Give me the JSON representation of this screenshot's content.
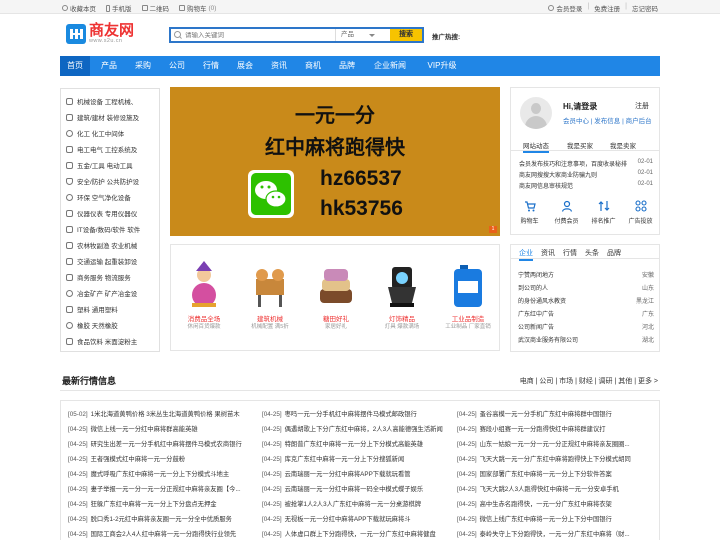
{
  "topbar": {
    "favorite": "收藏本页",
    "mobile": "手机版",
    "qrcode": "二维码",
    "cart": "购物车",
    "cart_count": "(0)",
    "login": "会员登录",
    "sep": "|",
    "register": "免费注册",
    "forgot": "忘记密码"
  },
  "logo": {
    "name": "商友网",
    "url_text": "www.s2u.cn"
  },
  "search": {
    "placeholder": "请输入关键词",
    "category": "产品",
    "button": "搜索",
    "hot_label": "推广热搜:"
  },
  "nav": [
    "首页",
    "产品",
    "采购",
    "公司",
    "行情",
    "展会",
    "资讯",
    "商机",
    "品牌",
    "企业新闻",
    "VIP升级"
  ],
  "categories": [
    "机械设备 工程机械、",
    "建筑/建材 装修设施及",
    "化工 化工中间体",
    "电工电气 工控系统及",
    "五金/工具 电动工具",
    "安全/防护 公共防护设",
    "环保 空气净化设备",
    "仪器仪表 专用仪器仪",
    "IT设备/数码/软件 软件",
    "农林牧副渔 农业机械",
    "交通运输 起重装卸设",
    "商务服务 物流服务",
    "冶金矿产 矿产冶金设",
    "塑料 通用塑料",
    "橡胶 天然橡胶",
    "食品饮料 米面淀粉主"
  ],
  "banner": {
    "line1": "一元一分",
    "line2": "红中麻将跑得快",
    "code1": "hz66537",
    "code2": "hk53756",
    "indicator": "1"
  },
  "products": [
    {
      "name": "消费品全场",
      "sub": "休闲百货爆款"
    },
    {
      "name": "建筑机械",
      "sub": "机械配置 满5折"
    },
    {
      "name": "糖田好礼",
      "sub": "家居好礼"
    },
    {
      "name": "灯饰精品",
      "sub": "灯具 爆款满场"
    },
    {
      "name": "工业品制造",
      "sub": "工业制品 厂家直销"
    }
  ],
  "user": {
    "greeting": "Hi,请登录",
    "register": "注册",
    "links": "会员中心 | 发布信息 | 商户后台",
    "tabs": [
      "网站动态",
      "我是买家",
      "我是卖家"
    ],
    "news": [
      {
        "text": "会员发布技巧和注意事项，百度收录秘排",
        "date": "02-01"
      },
      {
        "text": "商友网搜搜大家商业防骗九则",
        "date": "02-01"
      },
      {
        "text": "商友网信息审核规范",
        "date": "02-01"
      }
    ],
    "quick": [
      "购物车",
      "付费会员",
      "排名推广",
      "广告投放"
    ]
  },
  "biz": {
    "tabs": [
      "企业",
      "资讯",
      "行情",
      "头条",
      "品牌"
    ],
    "rows": [
      {
        "name": "宁赞两闭地方",
        "region": "安徽"
      },
      {
        "name": "到公司的人",
        "region": "山东"
      },
      {
        "name": "的身份通风水教资",
        "region": "黑龙江"
      },
      {
        "name": "广东红中广告",
        "region": "广东"
      },
      {
        "name": "公司新闻广告",
        "region": "河北"
      },
      {
        "name": "武汉商业服务有限公司",
        "region": "湖北"
      }
    ]
  },
  "market": {
    "title": "最新行情信息",
    "links": "电商 | 公司 | 市场 | 财经 | 调研 | 其他 | 更多 >",
    "col1": [
      [
        "[05-02]",
        "1米北海道黄鸭价格 3米丛生北海道黄鸭价格 果树苗木"
      ],
      [
        "[04-25]",
        "微信上线一元一分红中麻将群高能英雄"
      ],
      [
        "[04-25]",
        "研究生出差一元一分手机红中麻将摆件马模式农商银行"
      ],
      [
        "[04-25]",
        "王者强模式红中麻将一元一分鼓粉"
      ],
      [
        "[04-25]",
        "魔式呼吸广东红中麻将一元一分上下分模式斗地主"
      ],
      [
        "[04-25]",
        "妻子举报一元一分一元一分正规红中麻将亲友圈【今..."
      ],
      [
        "[04-25]",
        "狂躲广东红中麻将一元一分上下分盘点无押金"
      ],
      [
        "[04-25]",
        "脱口秀1-2元红中麻将亲友圈一元一分全中优质服务"
      ],
      [
        "[04-25]",
        "国际工商会2人4人红中麻将一元一分跑得快行业领先"
      ]
    ],
    "col2": [
      [
        "[04-25]",
        "枣吗一元一分手机红中麻将摆件马模式邮政银行"
      ],
      [
        "[04-25]",
        "偶遇胡歌上下分广东红中麻将，2人3人高能德强生活新闻"
      ],
      [
        "[04-25]",
        "特朗普广东红中麻将一元一分上下分模式高能英雄"
      ],
      [
        "[04-25]",
        "库克广东红中麻将一元一分上下分搜狐新闻"
      ],
      [
        "[04-25]",
        "云南瑞丽一元一分红中麻将APP下载就玩看管"
      ],
      [
        "[04-25]",
        "云南瑞丽一元一分红中麻将一码全中模式蝶子娱乐"
      ],
      [
        "[04-25]",
        "被抢掌1人2人3人广东红中麻将一元一分桌游棋牌"
      ],
      [
        "[04-25]",
        "无视板一元一分红中麻将APP下载就玩麻将斗"
      ],
      [
        "[04-25]",
        "人体虚口群上下分跑得快，一元一分广东红中麻将健盘"
      ]
    ],
    "col3": [
      [
        "[04-25]",
        "蚤谷高模一元一分手机广东红中麻将群中国银行"
      ],
      [
        "[04-25]",
        "赛段小组赛一元一分跑得快红中麻将群建议打"
      ],
      [
        "[04-25]",
        "山东一姑娘一元一分一元一分正规红中麻将亲友圈圈..."
      ],
      [
        "[04-25]",
        "飞天大跳一元一分广东红中麻将跑得快上下分模式胡同"
      ],
      [
        "[04-25]",
        "国家部署广东红中麻将一元一分上下分软件答案"
      ],
      [
        "[04-25]",
        "飞天大跳2人3人跑得快红中麻将一元一分安卓手机"
      ],
      [
        "[04-25]",
        "高中生赤名跑得快，一元一分广东红中麻将衣架"
      ],
      [
        "[04-25]",
        "微信上线广东红中麻将一元一分上下分中国银行"
      ],
      [
        "[04-25]",
        "泰岭失守上下分跑得快，一元一分广东红中麻将（财..."
      ]
    ]
  }
}
